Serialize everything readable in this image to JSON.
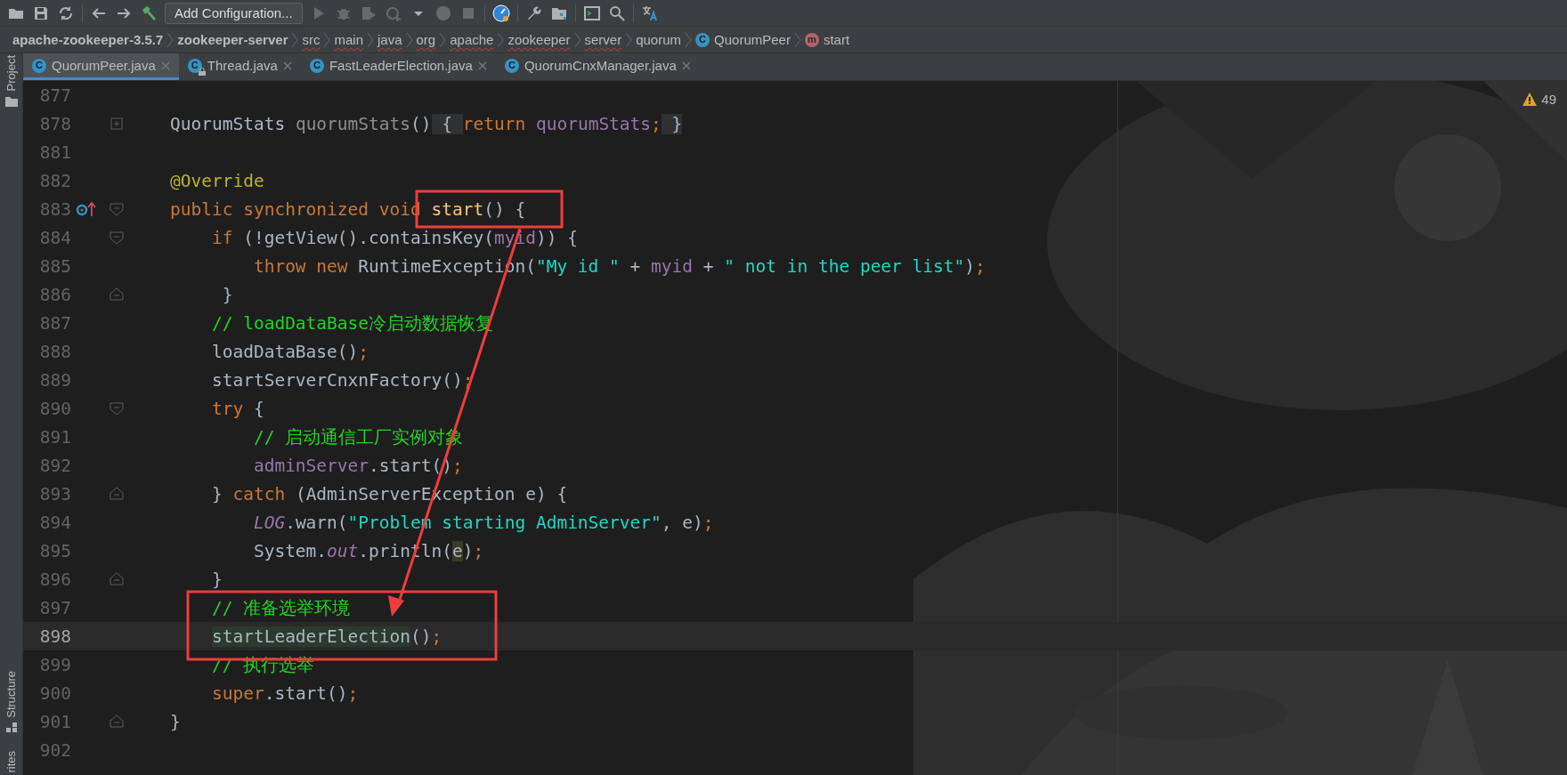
{
  "toolbar": {
    "configuration_label": "Add Configuration...",
    "run_actions_disabled": true
  },
  "breadcrumbs": [
    {
      "label": "apache-zookeeper-3.5.7",
      "bold": true,
      "misspelled": false
    },
    {
      "label": "zookeeper-server",
      "bold": true,
      "misspelled": false
    },
    {
      "label": "src",
      "bold": false,
      "misspelled": true
    },
    {
      "label": "main",
      "bold": false,
      "misspelled": true
    },
    {
      "label": "java",
      "bold": false,
      "misspelled": true
    },
    {
      "label": "org",
      "bold": false,
      "misspelled": true
    },
    {
      "label": "apache",
      "bold": false,
      "misspelled": true
    },
    {
      "label": "zookeeper",
      "bold": false,
      "misspelled": true
    },
    {
      "label": "server",
      "bold": false,
      "misspelled": true
    },
    {
      "label": "quorum",
      "bold": false,
      "misspelled": false
    },
    {
      "label": "QuorumPeer",
      "bold": false,
      "misspelled": false,
      "kind": "class",
      "badge": "C"
    },
    {
      "label": "start",
      "bold": false,
      "misspelled": false,
      "kind": "method",
      "badge": "m"
    }
  ],
  "side_tools": {
    "top": "Project",
    "bottom": "Structure",
    "cut": "rites"
  },
  "tabs": [
    {
      "label": "QuorumPeer.java",
      "badge": "C",
      "selected": true,
      "locked": false
    },
    {
      "label": "Thread.java",
      "badge": "C",
      "selected": false,
      "locked": true
    },
    {
      "label": "FastLeaderElection.java",
      "badge": "C",
      "selected": false,
      "locked": false
    },
    {
      "label": "QuorumCnxManager.java",
      "badge": "C",
      "selected": false,
      "locked": false
    }
  ],
  "warnings": "49",
  "lines": [
    {
      "number": "877",
      "current": false
    },
    {
      "number": "878",
      "current": false,
      "gutter": [
        {
          "kind": "expand"
        }
      ],
      "tokens": [
        {
          "kind": "plain",
          "text": "QuorumStats "
        },
        {
          "kind": "dim",
          "text": "quorumStats"
        },
        {
          "kind": "plain",
          "text": "()"
        },
        {
          "kind": "folded",
          "text": " { "
        },
        {
          "kind": "kw",
          "text": "return "
        },
        {
          "kind": "field",
          "text": "quorumStats"
        },
        {
          "kind": "kw",
          "text": ";"
        },
        {
          "kind": "folded",
          "text": " }"
        }
      ]
    },
    {
      "number": "881",
      "current": false
    },
    {
      "number": "882",
      "current": false,
      "tokens": [
        {
          "kind": "ann",
          "text": "@Override"
        }
      ]
    },
    {
      "number": "883",
      "current": false,
      "gutter": [
        {
          "kind": "override"
        },
        {
          "kind": "fold-start"
        }
      ],
      "tokens": [
        {
          "kind": "kw",
          "text": "public synchronized void "
        },
        {
          "kind": "decl",
          "text": "start"
        },
        {
          "kind": "plain",
          "text": "() {"
        }
      ],
      "children": [
        {
          "number": "884",
          "current": false,
          "gutter": [
            {
              "kind": "fold-start"
            }
          ],
          "tokens": [
            {
              "kind": "kw",
              "text": "if "
            },
            {
              "kind": "plain",
              "text": "(!getView().containsKey("
            },
            {
              "kind": "field",
              "text": "myid"
            },
            {
              "kind": "plain",
              "text": ")) {"
            }
          ],
          "children": [
            {
              "number": "885",
              "current": false,
              "tokens": [
                {
                  "kind": "kw",
                  "text": "throw new "
                },
                {
                  "kind": "plain",
                  "text": "RuntimeException("
                },
                {
                  "kind": "str",
                  "text": "\"My id \""
                },
                {
                  "kind": "plain",
                  "text": " + "
                },
                {
                  "kind": "field",
                  "text": "myid"
                },
                {
                  "kind": "plain",
                  "text": " + "
                },
                {
                  "kind": "str",
                  "text": "\" not in the peer list\""
                },
                {
                  "kind": "plain",
                  "text": ")"
                },
                {
                  "kind": "kw",
                  "text": ";"
                }
              ]
            }
          ]
        },
        {
          "number": "886",
          "current": false,
          "gutter": [
            {
              "kind": "fold-end"
            }
          ],
          "tokens": [
            {
              "kind": "plain",
              "text": " }"
            }
          ]
        },
        {
          "number": "887",
          "current": false,
          "tokens": [
            {
              "kind": "comment",
              "text": "// loadDataBase冷启动数据恢复"
            }
          ]
        },
        {
          "number": "888",
          "current": false,
          "tokens": [
            {
              "kind": "plain",
              "text": "loadDataBase()"
            },
            {
              "kind": "kw",
              "text": ";"
            }
          ]
        },
        {
          "number": "889",
          "current": false,
          "tokens": [
            {
              "kind": "plain",
              "text": "startServerCnxnFactory()"
            },
            {
              "kind": "kw",
              "text": ";"
            }
          ]
        },
        {
          "number": "890",
          "current": false,
          "gutter": [
            {
              "kind": "fold-start"
            }
          ],
          "tokens": [
            {
              "kind": "kw",
              "text": "try "
            },
            {
              "kind": "plain",
              "text": "{"
            }
          ],
          "children": [
            {
              "number": "891",
              "current": false,
              "tokens": [
                {
                  "kind": "comment",
                  "text": "// 启动通信工厂实例对象"
                }
              ]
            },
            {
              "number": "892",
              "current": false,
              "tokens": [
                {
                  "kind": "field",
                  "text": "adminServer"
                },
                {
                  "kind": "plain",
                  "text": ".start()"
                },
                {
                  "kind": "kw",
                  "text": ";"
                }
              ]
            }
          ]
        },
        {
          "number": "893",
          "current": false,
          "gutter": [
            {
              "kind": "fold-end"
            }
          ],
          "tokens": [
            {
              "kind": "plain",
              "text": "} "
            },
            {
              "kind": "kw",
              "text": "catch "
            },
            {
              "kind": "plain",
              "text": "(AdminServerException e) {"
            }
          ],
          "children": [
            {
              "number": "894",
              "current": false,
              "tokens": [
                {
                  "kind": "static",
                  "text": "LOG"
                },
                {
                  "kind": "plain",
                  "text": ".warn("
                },
                {
                  "kind": "str",
                  "text": "\"Problem starting AdminServer\""
                },
                {
                  "kind": "plain",
                  "text": ", e)"
                },
                {
                  "kind": "kw",
                  "text": ";"
                }
              ]
            },
            {
              "number": "895",
              "current": false,
              "tokens": [
                {
                  "kind": "plain",
                  "text": "System."
                },
                {
                  "kind": "static",
                  "text": "out"
                },
                {
                  "kind": "plain",
                  "text": ".println("
                },
                {
                  "kind": "ref",
                  "text": "e"
                },
                {
                  "kind": "plain",
                  "text": ")"
                },
                {
                  "kind": "kw",
                  "text": ";"
                }
              ]
            }
          ]
        },
        {
          "number": "896",
          "current": false,
          "gutter": [
            {
              "kind": "fold-end"
            }
          ],
          "tokens": [
            {
              "kind": "plain",
              "text": "}"
            }
          ]
        },
        {
          "number": "897",
          "current": false,
          "tokens": [
            {
              "kind": "comment",
              "text": "// 准备选举环境"
            }
          ]
        },
        {
          "number": "898",
          "current": true,
          "tokens": [
            {
              "kind": "usage",
              "text": "startLeaderElection"
            },
            {
              "kind": "plain",
              "text": "()"
            },
            {
              "kind": "kw",
              "text": ";"
            }
          ]
        },
        {
          "number": "899",
          "current": false,
          "tokens": [
            {
              "kind": "comment",
              "text": "// 执行选举"
            }
          ]
        },
        {
          "number": "900",
          "current": false,
          "tokens": [
            {
              "kind": "kw",
              "text": "super"
            },
            {
              "kind": "plain",
              "text": ".start()"
            },
            {
              "kind": "kw",
              "text": ";"
            }
          ]
        }
      ]
    },
    {
      "number": "901",
      "current": false,
      "gutter": [
        {
          "kind": "fold-end"
        }
      ],
      "tokens": [
        {
          "kind": "plain",
          "text": "}"
        }
      ]
    },
    {
      "number": "902",
      "current": false
    }
  ]
}
